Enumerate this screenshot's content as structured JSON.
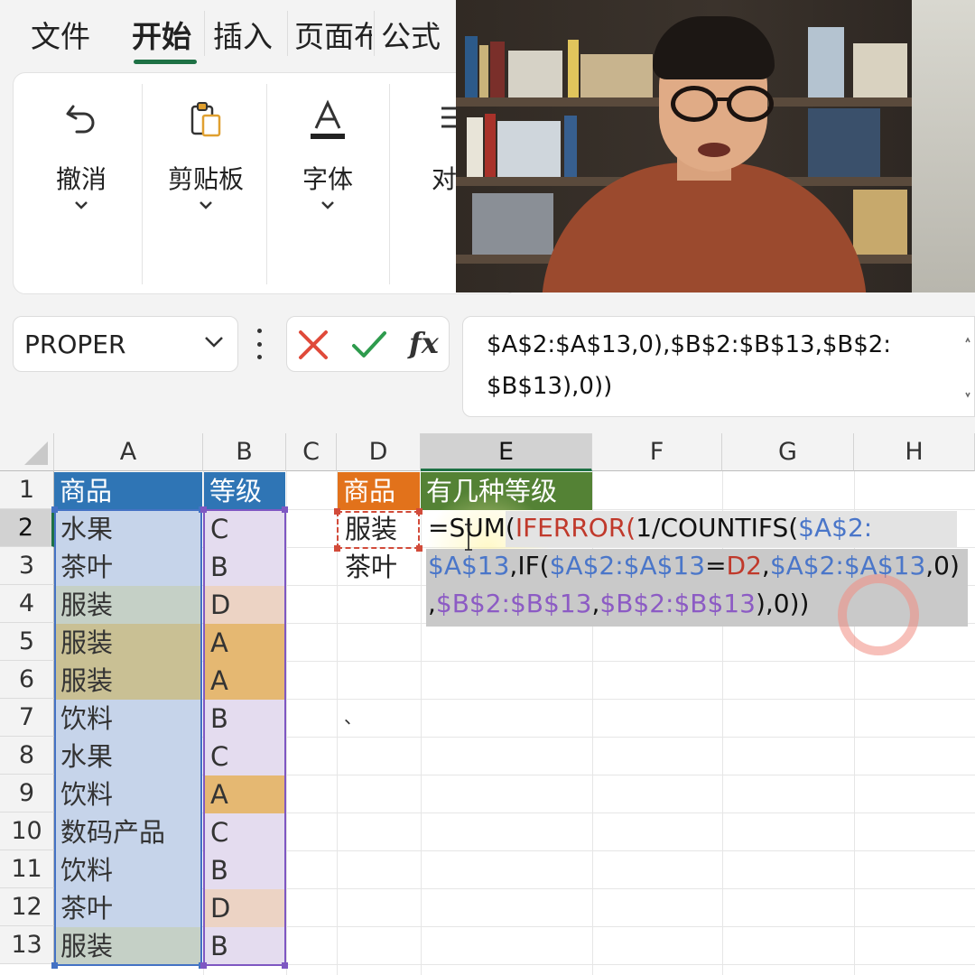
{
  "ribbon_tabs": [
    {
      "label": "文件",
      "active": false
    },
    {
      "label": "开始",
      "active": true
    },
    {
      "label": "插入",
      "active": false
    },
    {
      "label": "页面布",
      "active": false
    },
    {
      "label": "公式",
      "active": false
    }
  ],
  "ribbon_groups": [
    {
      "label": "撤消",
      "icon": "undo-icon"
    },
    {
      "label": "剪贴板",
      "icon": "clipboard-icon"
    },
    {
      "label": "字体",
      "icon": "font-color-icon"
    },
    {
      "label": "对齐",
      "icon": "align-icon"
    }
  ],
  "formula_bar": {
    "name_box": "PROPER",
    "cancel_icon": "cancel-x-icon",
    "enter_icon": "enter-check-icon",
    "fx_label": "fx",
    "formula_line1": "$A$2:$A$13,0),$B$2:$B$13,$B$2:",
    "formula_line2": "$B$13),0))"
  },
  "columns": [
    "A",
    "B",
    "C",
    "D",
    "E",
    "F",
    "G",
    "H"
  ],
  "selected_column": "E",
  "rows": [
    "1",
    "2",
    "3",
    "4",
    "5",
    "6",
    "7",
    "8",
    "9",
    "10",
    "11",
    "12",
    "13"
  ],
  "selected_row": "2",
  "table_a": {
    "header": "商品",
    "values": [
      "水果",
      "茶叶",
      "服装",
      "服装",
      "服装",
      "饮料",
      "水果",
      "饮料",
      "数码产品",
      "饮料",
      "茶叶",
      "服装"
    ]
  },
  "table_b": {
    "header": "等级",
    "values": [
      "C",
      "B",
      "D",
      "A",
      "A",
      "B",
      "C",
      "A",
      "C",
      "B",
      "D",
      "B"
    ]
  },
  "summary": {
    "d_header": "商品",
    "e_header": "有几种等级",
    "d_values": [
      "服装",
      "茶叶"
    ]
  },
  "editing_formula": {
    "l1_a": "=SUM(",
    "l1_b": "IFERROR(",
    "l1_c": "1/COUNTIFS(",
    "l1_d": "$A$2:",
    "l2_a": "$A$13",
    "l2_b": ",IF(",
    "l2_c": "$A$2:$A$13",
    "l2_d": "=",
    "l2_e": "D2",
    "l2_f": ",",
    "l2_g": "$A$2:$A$13",
    "l2_h": ",0)",
    "l3_a": ",",
    "l3_b": "$B$2:$B$13",
    "l3_c": ",",
    "l3_d": "$B$2:$B$13",
    "l3_e": ")",
    "l3_f": ",0))"
  },
  "stray_mark": "、",
  "colors": {
    "accent": "#1e7145",
    "header_blue": "#2f75b5",
    "header_orange": "#e2721b",
    "header_green": "#548235",
    "fill_blue": "#c6d4ea",
    "fill_purple": "#e4dcef",
    "fill_gray_green": "#c5d0c6",
    "fill_orange": "#e5b872",
    "fill_peach": "#ecd3c4",
    "fill_olive": "#c9c094"
  }
}
